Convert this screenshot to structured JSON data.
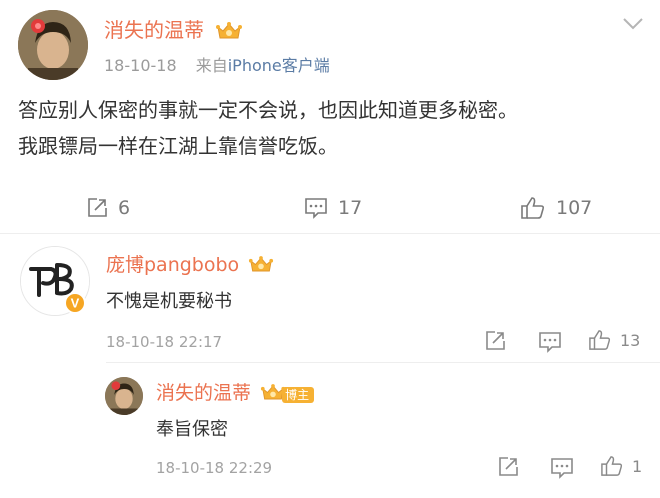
{
  "post": {
    "author": "消失的温蒂",
    "time": "18-10-18",
    "source_prefix": "来自",
    "source": "iPhone客户端",
    "text_line1": "答应别人保密的事就一定不会说，也因此知道更多秘密。",
    "text_line2": "我跟镖局一样在江湖上靠信誉吃饭。",
    "reposts": "6",
    "comments": "17",
    "likes": "107"
  },
  "comments": [
    {
      "author": "庞博pangbobo",
      "text": "不愧是机要秘书",
      "time": "18-10-18 22:17",
      "likes": "13",
      "avatar_text": "PB",
      "verified_mark": "V"
    }
  ],
  "reply": {
    "author": "消失的温蒂",
    "badge": "博主",
    "text": "奉旨保密",
    "time": "18-10-18 22:29",
    "likes": "1"
  },
  "icons": {
    "menu": "chevron-down-icon",
    "repost": "repost-icon",
    "comment": "comment-icon",
    "like": "thumbs-up-icon",
    "crown": "crown-badge-icon"
  },
  "colors": {
    "username": "#eb7350",
    "link": "#5b7ca5",
    "meta": "#9b9b9b",
    "crown": "#f6b133"
  }
}
